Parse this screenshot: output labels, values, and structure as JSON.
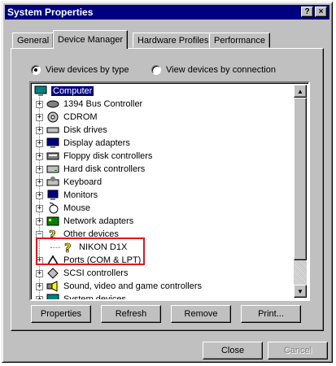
{
  "window": {
    "title": "System Properties"
  },
  "titlebar": {
    "help_glyph": "?",
    "close_glyph": "×"
  },
  "tabs": [
    "General",
    "Device Manager",
    "Hardware Profiles",
    "Performance"
  ],
  "view": {
    "by_type": "View devices by type",
    "by_connection": "View devices by connection",
    "selected": "by_type"
  },
  "tree": {
    "root": "Computer",
    "items": [
      {
        "label": "1394 Bus Controller",
        "icon": "bus-icon",
        "expander": "+"
      },
      {
        "label": "CDROM",
        "icon": "cdrom-icon",
        "expander": "+"
      },
      {
        "label": "Disk drives",
        "icon": "disk-icon",
        "expander": "+"
      },
      {
        "label": "Display adapters",
        "icon": "display-icon",
        "expander": "+"
      },
      {
        "label": "Floppy disk controllers",
        "icon": "floppy-icon",
        "expander": "+"
      },
      {
        "label": "Hard disk controllers",
        "icon": "hdd-icon",
        "expander": "+"
      },
      {
        "label": "Keyboard",
        "icon": "keyboard-icon",
        "expander": "+"
      },
      {
        "label": "Monitors",
        "icon": "monitor-icon",
        "expander": "+"
      },
      {
        "label": "Mouse",
        "icon": "mouse-icon",
        "expander": "+"
      },
      {
        "label": "Network adapters",
        "icon": "network-icon",
        "expander": "+"
      },
      {
        "label": "Other devices",
        "icon": "question-icon",
        "expander": "−"
      },
      {
        "label": "NIKON D1X",
        "icon": "question-icon",
        "expander": "",
        "child": true
      },
      {
        "label": "Ports (COM & LPT)",
        "icon": "port-icon",
        "expander": "+"
      },
      {
        "label": "SCSI controllers",
        "icon": "scsi-icon",
        "expander": "+"
      },
      {
        "label": "Sound, video and game controllers",
        "icon": "sound-icon",
        "expander": "+"
      },
      {
        "label": "System devices",
        "icon": "system-icon",
        "expander": "+"
      }
    ]
  },
  "buttons": {
    "properties": "Properties",
    "refresh": "Refresh",
    "remove": "Remove",
    "print": "Print...",
    "close": "Close",
    "cancel": "Cancel"
  },
  "colors": {
    "title_bar": "#000080",
    "face": "#c0c0c0",
    "highlight_box": "#e8141d",
    "question_mark": "#e6e600"
  }
}
